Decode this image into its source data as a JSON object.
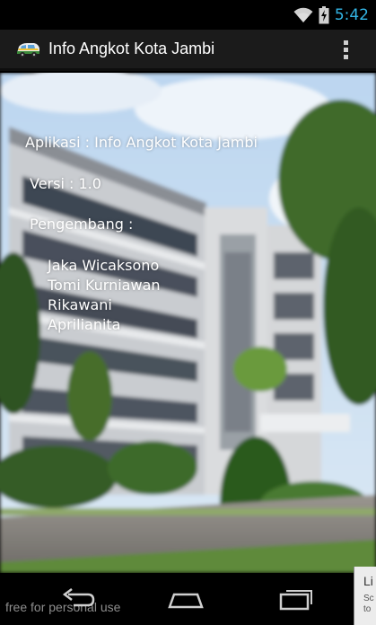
{
  "status_bar": {
    "time": "5:42",
    "icons": [
      "wifi-icon",
      "battery-charging-icon"
    ],
    "time_color": "#33b5e5"
  },
  "action_bar": {
    "title": "Info Angkot Kota Jambi",
    "icon": "angkot-app-icon",
    "menu_icon": "overflow-menu-icon"
  },
  "info": {
    "app_line": "Aplikasi : Info Angkot Kota Jambi",
    "version_line": "Versi : 1.0",
    "developer_label": "Pengembang :",
    "developers": [
      "Jaka Wicaksono",
      "Tomi Kurniawan",
      "Rikawani",
      "Aprilianita"
    ]
  },
  "nav_bar": {
    "buttons": [
      "back-icon",
      "home-icon",
      "recent-apps-icon"
    ],
    "watermark": "free for personal use"
  },
  "side_snippet": {
    "title": "Li",
    "line1": "Sc",
    "line2": "to"
  }
}
